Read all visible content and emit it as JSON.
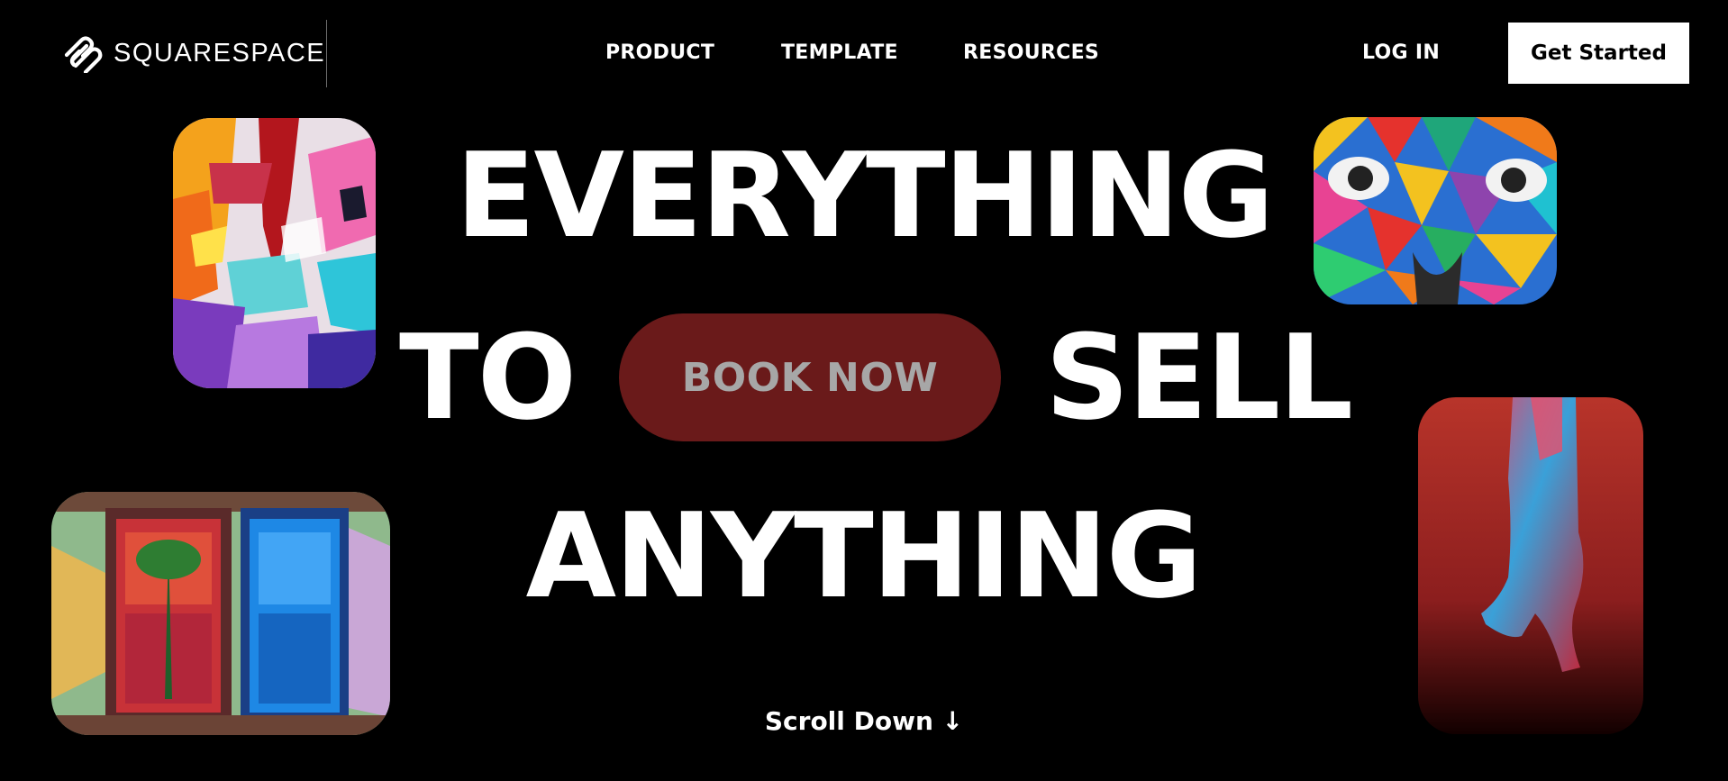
{
  "brand": {
    "name": "SQUARESPACE",
    "logo_icon": "squarespace-logo-icon"
  },
  "nav": {
    "items": [
      {
        "label": "PRODUCT"
      },
      {
        "label": "TEMPLATE"
      },
      {
        "label": "RESOURCES"
      }
    ],
    "login_label": "LOG IN",
    "cta_label": "Get Started"
  },
  "hero": {
    "line1": "EVERYTHING",
    "line2_left": "TO",
    "book_label": "BOOK NOW",
    "line2_right": "SELL",
    "line3": "ANYTHING"
  },
  "scroll_label": "Scroll Down ↓",
  "colors": {
    "background": "#000000",
    "text": "#ffffff",
    "book_button_bg": "#6a1a1a",
    "book_button_text": "#a7a7a7",
    "cta_bg": "#ffffff"
  }
}
